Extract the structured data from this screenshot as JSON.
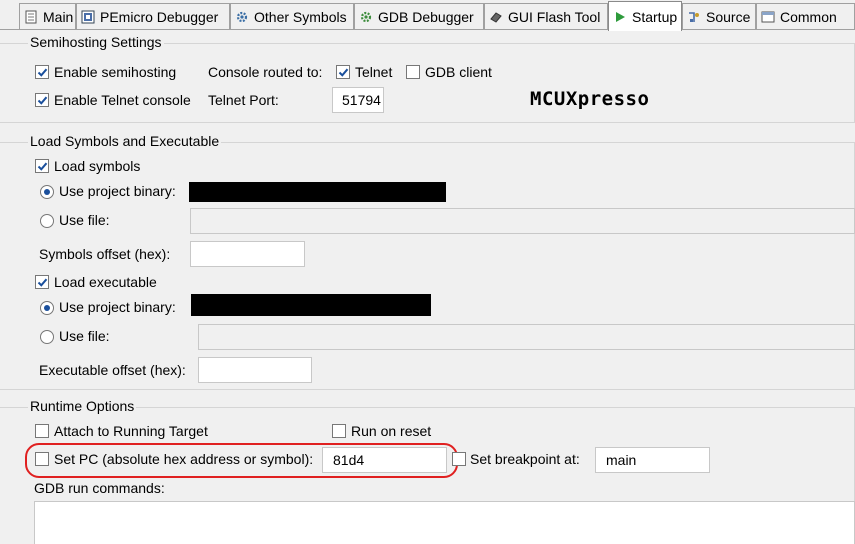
{
  "tabs": [
    {
      "label": "Main",
      "icon": "main-page-icon"
    },
    {
      "label": "PEmicro Debugger",
      "icon": "debugger-icon"
    },
    {
      "label": "Other Symbols",
      "icon": "gear-icon"
    },
    {
      "label": "GDB Debugger",
      "icon": "gear-icon"
    },
    {
      "label": "GUI Flash Tool",
      "icon": "flash-tool-icon"
    },
    {
      "label": "Startup",
      "icon": "play-icon",
      "active": true
    },
    {
      "label": "Source",
      "icon": "source-icon"
    },
    {
      "label": "Common",
      "icon": "common-icon"
    }
  ],
  "semihosting": {
    "title": "Semihosting Settings",
    "enable_semihosting": {
      "label": "Enable semihosting",
      "checked": true
    },
    "console_routed_label": "Console routed to:",
    "telnet": {
      "label": "Telnet",
      "checked": true
    },
    "gdb_client": {
      "label": "GDB client",
      "checked": false
    },
    "enable_telnet_console": {
      "label": "Enable Telnet console",
      "checked": true
    },
    "telnet_port_label": "Telnet Port:",
    "telnet_port_value": "51794",
    "brand": "MCUXpresso"
  },
  "load": {
    "title": "Load Symbols and Executable",
    "load_symbols": {
      "label": "Load symbols",
      "checked": true
    },
    "sym_use_project_binary": {
      "label": "Use project binary:",
      "selected": true
    },
    "sym_use_file": {
      "label": "Use file:",
      "selected": false
    },
    "symbols_offset_label": "Symbols offset (hex):",
    "symbols_offset_value": "",
    "load_executable": {
      "label": "Load executable",
      "checked": true
    },
    "exe_use_project_binary": {
      "label": "Use project binary:",
      "selected": true
    },
    "exe_use_file": {
      "label": "Use file:",
      "selected": false
    },
    "executable_offset_label": "Executable offset (hex):",
    "executable_offset_value": ""
  },
  "runtime": {
    "title": "Runtime Options",
    "attach_running": {
      "label": "Attach to Running Target",
      "checked": false
    },
    "run_on_reset": {
      "label": "Run on reset",
      "checked": false
    },
    "set_pc": {
      "label": "Set PC (absolute hex address or symbol):",
      "checked": false
    },
    "set_pc_value": "81d4",
    "set_breakpoint": {
      "label": "Set breakpoint at:",
      "checked": false
    },
    "breakpoint_value": "main",
    "gdb_run_commands_label": "GDB run commands:"
  },
  "colors": {
    "highlight": "#e02020",
    "radio_dot": "#1a4f9c",
    "check": "#1a4f9c"
  }
}
